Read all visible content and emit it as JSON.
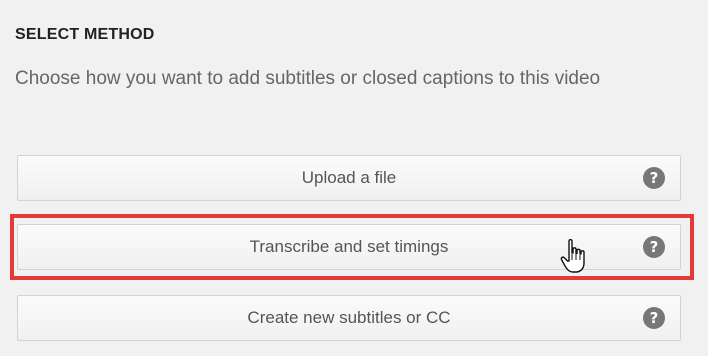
{
  "section": {
    "title": "SELECT METHOD",
    "description": "Choose how you want to add subtitles or closed captions to this video"
  },
  "methods": [
    {
      "label": "Upload a file",
      "help_icon": "question-circle-icon",
      "help_glyph": "?"
    },
    {
      "label": "Transcribe and set timings",
      "help_icon": "question-circle-icon",
      "help_glyph": "?"
    },
    {
      "label": "Create new subtitles or CC",
      "help_icon": "question-circle-icon",
      "help_glyph": "?"
    }
  ],
  "highlight": {
    "color": "#e53935",
    "target": "Transcribe and set timings"
  },
  "cursor": {
    "icon": "hand-pointer-icon"
  },
  "colors": {
    "panel_background": "#f1f1f1",
    "title_text": "#222222",
    "description_text": "#666666",
    "button_text": "#555555",
    "help_icon_bg": "#777777"
  }
}
